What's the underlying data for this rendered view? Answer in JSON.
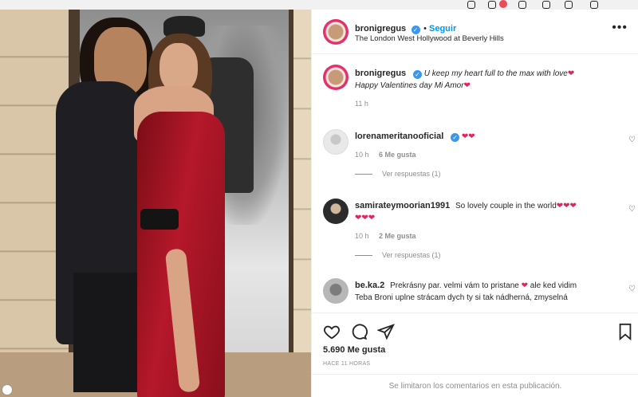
{
  "post": {
    "username": "bronigregus",
    "follow_label": "Seguir",
    "location": "The London West Hollywood at Beverly Hills",
    "caption_line1": "U keep my heart full to the max with love",
    "caption_line2": "Happy Valentines day Mi Amor",
    "caption_time": "11 h",
    "likes": "5.690 Me gusta",
    "time_ago": "HACE 11 HORAS",
    "comments_limited": "Se limitaron los comentarios en esta publicación."
  },
  "comments": [
    {
      "username": "lorenameritanooficial",
      "text": "",
      "hearts": "❤❤",
      "time": "10 h",
      "likes": "6 Me gusta",
      "replies": "Ver respuestas (1)"
    },
    {
      "username": "samirateymoorian1991",
      "text": "So lovely couple in the world",
      "hearts": "❤❤❤",
      "hearts_line2": "❤❤❤",
      "time": "10 h",
      "likes": "2 Me gusta",
      "replies": "Ver respuestas (1)"
    },
    {
      "username": "be.ka.2",
      "text_before": "Prekrásny par. velmi vám to pristane",
      "heart": "❤",
      "text_after": "ale ked vidim",
      "text_line2": "Teba Broni uplne strácam dych ty si tak nádherná, zmyselná"
    }
  ],
  "icons": {
    "more": "more-options-icon",
    "verified": "verified-badge-icon",
    "like": "heart-icon",
    "comment": "comment-icon",
    "share": "share-icon",
    "save": "bookmark-icon"
  },
  "colors": {
    "link": "#0095f6",
    "verified": "#3897f0",
    "heart": "#e0245e",
    "muted": "#8e8e8e"
  }
}
